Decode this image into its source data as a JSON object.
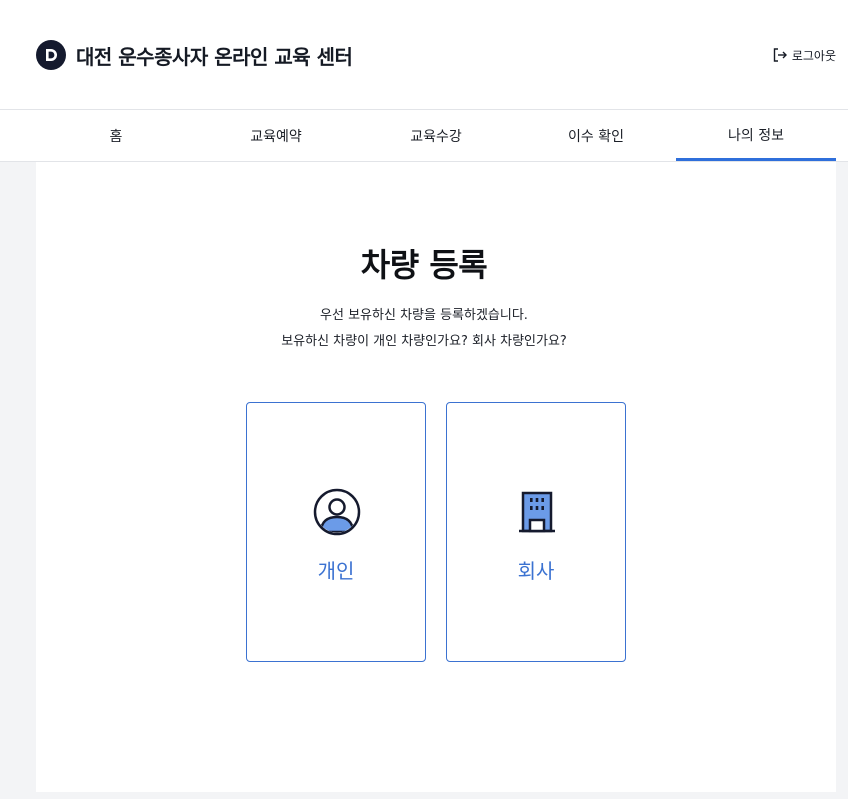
{
  "header": {
    "title": "대전 운수종사자 온라인 교육 센터",
    "logout_label": "로그아웃"
  },
  "nav": {
    "items": [
      {
        "label": "홈"
      },
      {
        "label": "교육예약"
      },
      {
        "label": "교육수강"
      },
      {
        "label": "이수 확인"
      },
      {
        "label": "나의 정보"
      }
    ],
    "active": "나의 정보"
  },
  "main": {
    "title": "차량 등록",
    "description_line1": "우선 보유하신 차량을 등록하겠습니다.",
    "description_line2": "보유하신 차량이 개인 차량인가요? 회사 차량인가요?",
    "options": [
      {
        "label": "개인",
        "icon": "person-icon"
      },
      {
        "label": "회사",
        "icon": "building-icon"
      }
    ]
  },
  "colors": {
    "accent": "#2f6fdb",
    "option_blue": "#3b72d1",
    "logo_navy": "#151a2e",
    "icon_fill": "#6b9be8"
  }
}
